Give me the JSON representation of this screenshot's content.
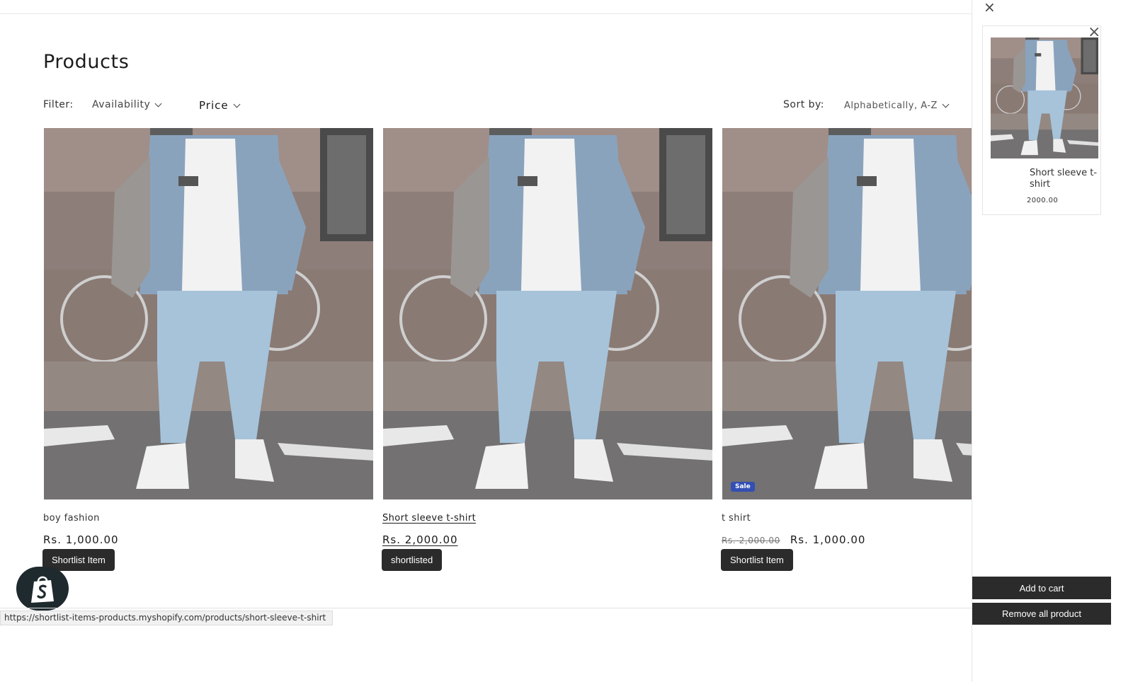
{
  "collection": {
    "title": "Products",
    "filter_label": "Filter:",
    "filters": [
      "Availability",
      "Price"
    ],
    "sort_label": "Sort by:",
    "sort_value": "Alphabetically, A-Z"
  },
  "products": [
    {
      "title": "boy fashion",
      "price": "Rs. 1,000.00",
      "compare_price": "",
      "badge": "",
      "button_label": "Shortlist Item",
      "hovered": false
    },
    {
      "title": "Short sleeve t-shirt",
      "price": "Rs. 2,000.00",
      "compare_price": "",
      "badge": "",
      "button_label": "shortlisted",
      "hovered": true
    },
    {
      "title": "t shirt",
      "price": "Rs. 1,000.00",
      "compare_price": "Rs. 2,000.00",
      "badge": "Sale",
      "button_label": "Shortlist Item",
      "hovered": false
    }
  ],
  "shortlist_panel": {
    "close_icon": "×",
    "item": {
      "title": "Short sleeve t-shirt",
      "price": "2000.00",
      "remove_icon": "×"
    },
    "add_to_cart_label": "Add to cart",
    "remove_all_label": "Remove all product"
  },
  "status_bar": {
    "url": "https://shortlist-items-products.myshopify.com/products/short-sleeve-t-shirt"
  },
  "colors": {
    "button_dark": "#2b2b2b",
    "sale_badge": "#334fb4",
    "shopify_badge": "#1f2a2e"
  }
}
